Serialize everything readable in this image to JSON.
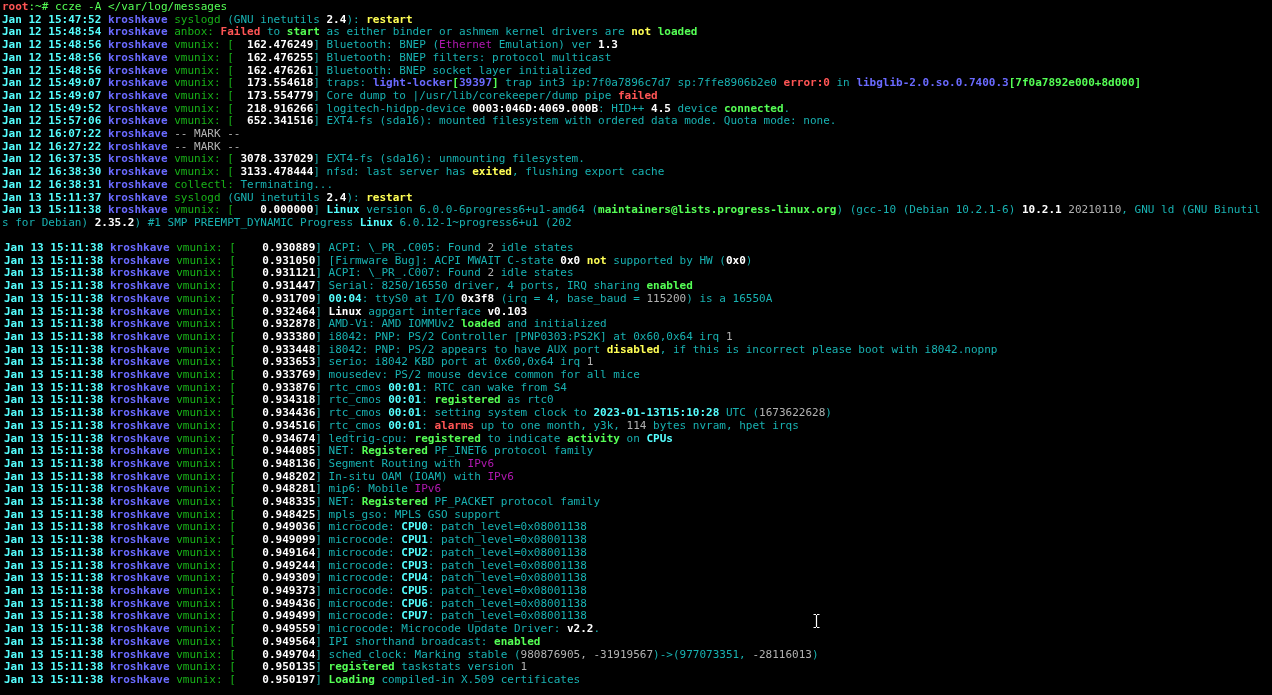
{
  "top_pane": {
    "lines": [
      {
        "segs": [
          {
            "kind": "user",
            "text": "root"
          },
          {
            "kind": "prompt",
            "text": ":~# ccze -A </var/log/messages"
          }
        ]
      },
      {
        "date": "Jan 12 15:47:52",
        "host": "kroshkave",
        "segs": [
          {
            "kind": "prog",
            "text": "syslogd"
          },
          {
            "kind": "msg",
            "text": " (GNU inetutils "
          },
          {
            "kind": "white",
            "text": "2.4"
          },
          {
            "kind": "msg",
            "text": "): "
          },
          {
            "kind": "warn",
            "text": "restart"
          }
        ]
      },
      {
        "date": "Jan 12 15:48:54",
        "host": "kroshkave",
        "segs": [
          {
            "kind": "prog",
            "text": "anbox:"
          },
          {
            "kind": "bad",
            "text": " Failed"
          },
          {
            "kind": "msg",
            "text": " to "
          },
          {
            "kind": "good",
            "text": "start"
          },
          {
            "kind": "msg",
            "text": " as either binder or ashmem kernel drivers are "
          },
          {
            "kind": "warn",
            "text": "not"
          },
          {
            "kind": "good",
            "text": " loaded"
          }
        ]
      },
      {
        "date": "Jan 12 15:48:56",
        "host": "kroshkave",
        "segs": [
          {
            "kind": "prog",
            "text": "vmunix: ["
          },
          {
            "kind": "white",
            "text": "  162.476249"
          },
          {
            "kind": "msg",
            "text": "] Bluetooth: BNEP ("
          },
          {
            "kind": "purple",
            "text": "Ethernet"
          },
          {
            "kind": "msg",
            "text": " Emulation) ver "
          },
          {
            "kind": "white",
            "text": "1.3"
          }
        ]
      },
      {
        "date": "Jan 12 15:48:56",
        "host": "kroshkave",
        "segs": [
          {
            "kind": "prog",
            "text": "vmunix: ["
          },
          {
            "kind": "white",
            "text": "  162.476255"
          },
          {
            "kind": "msg",
            "text": "] Bluetooth: BNEP filters: protocol multicast"
          }
        ]
      },
      {
        "date": "Jan 12 15:48:56",
        "host": "kroshkave",
        "segs": [
          {
            "kind": "prog",
            "text": "vmunix: ["
          },
          {
            "kind": "white",
            "text": "  162.476261"
          },
          {
            "kind": "msg",
            "text": "] Bluetooth: BNEP socket layer initialized"
          }
        ]
      },
      {
        "date": "Jan 12 15:49:07",
        "host": "kroshkave",
        "segs": [
          {
            "kind": "prog",
            "text": "vmunix: ["
          },
          {
            "kind": "white",
            "text": "  173.554618"
          },
          {
            "kind": "msg",
            "text": "] traps: "
          },
          {
            "kind": "blue",
            "text": "light-locker"
          },
          {
            "kind": "good",
            "text": "["
          },
          {
            "kind": "blue",
            "text": "39397"
          },
          {
            "kind": "good",
            "text": "]"
          },
          {
            "kind": "msg",
            "text": " trap int3 ip:7f0a7896c7d7 sp:7ffe8906b2e0 "
          },
          {
            "kind": "bad",
            "text": "error:0"
          },
          {
            "kind": "msg",
            "text": " in "
          },
          {
            "kind": "blue",
            "text": "libglib-2.0.so.0.7400.3"
          },
          {
            "kind": "good",
            "text": "[7f0a7892e000+8d000]"
          }
        ]
      },
      {
        "date": "Jan 12 15:49:07",
        "host": "kroshkave",
        "segs": [
          {
            "kind": "prog",
            "text": "vmunix: ["
          },
          {
            "kind": "white",
            "text": "  173.554779"
          },
          {
            "kind": "msg",
            "text": "] Core dump to |/usr/lib/corekeeper/dump pipe "
          },
          {
            "kind": "bad",
            "text": "failed"
          }
        ]
      },
      {
        "date": "Jan 12 15:49:52",
        "host": "kroshkave",
        "segs": [
          {
            "kind": "prog",
            "text": "vmunix: ["
          },
          {
            "kind": "white",
            "text": "  218.916266"
          },
          {
            "kind": "msg",
            "text": "] logitech-hidpp-device "
          },
          {
            "kind": "white",
            "text": "0003:046D:4069.000B"
          },
          {
            "kind": "msg",
            "text": ": HID++ "
          },
          {
            "kind": "white",
            "text": "4.5"
          },
          {
            "kind": "msg",
            "text": " device "
          },
          {
            "kind": "good",
            "text": "connected"
          },
          {
            "kind": "msg",
            "text": "."
          }
        ]
      },
      {
        "date": "Jan 12 15:57:06",
        "host": "kroshkave",
        "segs": [
          {
            "kind": "prog",
            "text": "vmunix: ["
          },
          {
            "kind": "white",
            "text": "  652.341516"
          },
          {
            "kind": "msg",
            "text": "] EXT4-fs (sda16): mounted filesystem with ordered data mode. Quota mode: none."
          }
        ]
      },
      {
        "date": "Jan 12 16:07:22",
        "host": "kroshkave",
        "segs": [
          {
            "kind": "gray",
            "text": "-- MARK --"
          }
        ]
      },
      {
        "date": "Jan 12 16:27:22",
        "host": "kroshkave",
        "segs": [
          {
            "kind": "gray",
            "text": "-- MARK --"
          }
        ]
      },
      {
        "date": "Jan 12 16:37:35",
        "host": "kroshkave",
        "segs": [
          {
            "kind": "prog",
            "text": "vmunix: ["
          },
          {
            "kind": "white",
            "text": " 3078.337029"
          },
          {
            "kind": "msg",
            "text": "] EXT4-fs (sda16): unmounting filesystem."
          }
        ]
      },
      {
        "date": "Jan 12 16:38:30",
        "host": "kroshkave",
        "segs": [
          {
            "kind": "prog",
            "text": "vmunix: ["
          },
          {
            "kind": "white",
            "text": " 3133.478444"
          },
          {
            "kind": "msg",
            "text": "] nfsd: last server has "
          },
          {
            "kind": "warn",
            "text": "exited"
          },
          {
            "kind": "msg",
            "text": ", flushing export cache"
          }
        ]
      },
      {
        "date": "Jan 12 16:38:31",
        "host": "kroshkave",
        "segs": [
          {
            "kind": "prog",
            "text": "collectl:"
          },
          {
            "kind": "msg",
            "text": " Terminating..."
          }
        ]
      },
      {
        "date": "Jan 13 15:11:37",
        "host": "kroshkave",
        "segs": [
          {
            "kind": "prog",
            "text": "syslogd"
          },
          {
            "kind": "msg",
            "text": " (GNU inetutils "
          },
          {
            "kind": "white",
            "text": "2.4"
          },
          {
            "kind": "msg",
            "text": "): "
          },
          {
            "kind": "warn",
            "text": "restart"
          }
        ]
      },
      {
        "date": "Jan 13 15:11:38",
        "host": "kroshkave",
        "segs": [
          {
            "kind": "prog",
            "text": "vmunix: ["
          },
          {
            "kind": "white",
            "text": "    0.000000"
          },
          {
            "kind": "msg",
            "text": "] "
          },
          {
            "kind": "cyan",
            "text": "Linux"
          },
          {
            "kind": "msg",
            "text": " version 6.0.0-6progress6+u1-amd64 ("
          },
          {
            "kind": "good",
            "text": "maintainers@lists.progress-linux.org"
          },
          {
            "kind": "msg",
            "text": ") (gcc-10 (Debian 10.2.1-6) "
          },
          {
            "kind": "white",
            "text": "10.2.1"
          },
          {
            "kind": "gray",
            "text": " 20210110"
          },
          {
            "kind": "msg",
            "text": ", GNU ld (GNU Binutil"
          }
        ]
      },
      {
        "segs": [
          {
            "kind": "msg",
            "text": "s for Debian) "
          },
          {
            "kind": "white",
            "text": "2.35.2"
          },
          {
            "kind": "msg",
            "text": ") #1 SMP PREEMPT_DYNAMIC Progress "
          },
          {
            "kind": "cyan",
            "text": "Linux"
          },
          {
            "kind": "msg",
            "text": " 6.0.12-1~progress6+u1 (202"
          }
        ]
      }
    ]
  },
  "bottom_pane": {
    "lines": [
      {
        "date": "Jan 13 15:11:38",
        "host": "kroshkave",
        "segs": [
          {
            "kind": "prog",
            "text": "vmunix: ["
          },
          {
            "kind": "white",
            "text": "    0.930889"
          },
          {
            "kind": "msg",
            "text": "] ACPI: \\_PR_.C005: Found "
          },
          {
            "kind": "gray",
            "text": "2"
          },
          {
            "kind": "msg",
            "text": " idle states"
          }
        ]
      },
      {
        "date": "Jan 13 15:11:38",
        "host": "kroshkave",
        "segs": [
          {
            "kind": "prog",
            "text": "vmunix: ["
          },
          {
            "kind": "white",
            "text": "    0.931050"
          },
          {
            "kind": "msg",
            "text": "] [Firmware Bug]: ACPI MWAIT C-state "
          },
          {
            "kind": "white",
            "text": "0x0"
          },
          {
            "kind": "warn",
            "text": " not"
          },
          {
            "kind": "msg",
            "text": " supported by HW ("
          },
          {
            "kind": "white",
            "text": "0x0"
          },
          {
            "kind": "msg",
            "text": ")"
          }
        ]
      },
      {
        "date": "Jan 13 15:11:38",
        "host": "kroshkave",
        "segs": [
          {
            "kind": "prog",
            "text": "vmunix: ["
          },
          {
            "kind": "white",
            "text": "    0.931121"
          },
          {
            "kind": "msg",
            "text": "] ACPI: \\_PR_.C007: Found "
          },
          {
            "kind": "gray",
            "text": "2"
          },
          {
            "kind": "msg",
            "text": " idle states"
          }
        ]
      },
      {
        "date": "Jan 13 15:11:38",
        "host": "kroshkave",
        "segs": [
          {
            "kind": "prog",
            "text": "vmunix: ["
          },
          {
            "kind": "white",
            "text": "    0.931447"
          },
          {
            "kind": "msg",
            "text": "] Serial: 8250/16550 driver, 4 ports, IRQ sharing "
          },
          {
            "kind": "good",
            "text": "enabled"
          }
        ]
      },
      {
        "date": "Jan 13 15:11:38",
        "host": "kroshkave",
        "segs": [
          {
            "kind": "prog",
            "text": "vmunix: ["
          },
          {
            "kind": "white",
            "text": "    0.931709"
          },
          {
            "kind": "msg",
            "text": "] "
          },
          {
            "kind": "cyan",
            "text": "00:04"
          },
          {
            "kind": "msg",
            "text": ": ttyS0 at I/O "
          },
          {
            "kind": "white",
            "text": "0x3f8"
          },
          {
            "kind": "msg",
            "text": " (irq = 4, base_baud = "
          },
          {
            "kind": "gray",
            "text": "115200"
          },
          {
            "kind": "msg",
            "text": ") is a 16550A"
          }
        ]
      },
      {
        "date": "Jan 13 15:11:38",
        "host": "kroshkave",
        "segs": [
          {
            "kind": "prog",
            "text": "vmunix: ["
          },
          {
            "kind": "white",
            "text": "    0.932464"
          },
          {
            "kind": "msg",
            "text": "] "
          },
          {
            "kind": "white",
            "text": "Linux"
          },
          {
            "kind": "msg",
            "text": " agpgart interface "
          },
          {
            "kind": "white",
            "text": "v0.103"
          }
        ]
      },
      {
        "date": "Jan 13 15:11:38",
        "host": "kroshkave",
        "segs": [
          {
            "kind": "prog",
            "text": "vmunix: ["
          },
          {
            "kind": "white",
            "text": "    0.932878"
          },
          {
            "kind": "msg",
            "text": "] AMD-Vi: AMD IOMMUv2 "
          },
          {
            "kind": "good",
            "text": "loaded"
          },
          {
            "kind": "msg",
            "text": " and initialized"
          }
        ]
      },
      {
        "date": "Jan 13 15:11:38",
        "host": "kroshkave",
        "segs": [
          {
            "kind": "prog",
            "text": "vmunix: ["
          },
          {
            "kind": "white",
            "text": "    0.933380"
          },
          {
            "kind": "msg",
            "text": "] i8042: PNP: PS/2 Controller [PNP0303:PS2K] at 0x60,0x64 irq "
          },
          {
            "kind": "gray",
            "text": "1"
          }
        ]
      },
      {
        "date": "Jan 13 15:11:38",
        "host": "kroshkave",
        "segs": [
          {
            "kind": "prog",
            "text": "vmunix: ["
          },
          {
            "kind": "white",
            "text": "    0.933448"
          },
          {
            "kind": "msg",
            "text": "] i8042: PNP: PS/2 appears to have AUX port "
          },
          {
            "kind": "warn",
            "text": "disabled"
          },
          {
            "kind": "msg",
            "text": ", if this is incorrect please boot with i8042.nopnp"
          }
        ]
      },
      {
        "date": "Jan 13 15:11:38",
        "host": "kroshkave",
        "segs": [
          {
            "kind": "prog",
            "text": "vmunix: ["
          },
          {
            "kind": "white",
            "text": "    0.933653"
          },
          {
            "kind": "msg",
            "text": "] serio: i8042 KBD port at 0x60,0x64 irq "
          },
          {
            "kind": "gray",
            "text": "1"
          }
        ]
      },
      {
        "date": "Jan 13 15:11:38",
        "host": "kroshkave",
        "segs": [
          {
            "kind": "prog",
            "text": "vmunix: ["
          },
          {
            "kind": "white",
            "text": "    0.933769"
          },
          {
            "kind": "msg",
            "text": "] mousedev: PS/2 mouse device common for all mice"
          }
        ]
      },
      {
        "date": "Jan 13 15:11:38",
        "host": "kroshkave",
        "segs": [
          {
            "kind": "prog",
            "text": "vmunix: ["
          },
          {
            "kind": "white",
            "text": "    0.933876"
          },
          {
            "kind": "msg",
            "text": "] rtc_cmos "
          },
          {
            "kind": "cyan",
            "text": "00:01"
          },
          {
            "kind": "msg",
            "text": ": RTC can wake from S4"
          }
        ]
      },
      {
        "date": "Jan 13 15:11:38",
        "host": "kroshkave",
        "segs": [
          {
            "kind": "prog",
            "text": "vmunix: ["
          },
          {
            "kind": "white",
            "text": "    0.934318"
          },
          {
            "kind": "msg",
            "text": "] rtc_cmos "
          },
          {
            "kind": "cyan",
            "text": "00:01"
          },
          {
            "kind": "msg",
            "text": ": "
          },
          {
            "kind": "good",
            "text": "registered"
          },
          {
            "kind": "msg",
            "text": " as rtc0"
          }
        ]
      },
      {
        "date": "Jan 13 15:11:38",
        "host": "kroshkave",
        "segs": [
          {
            "kind": "prog",
            "text": "vmunix: ["
          },
          {
            "kind": "white",
            "text": "    0.934436"
          },
          {
            "kind": "msg",
            "text": "] rtc_cmos "
          },
          {
            "kind": "cyan",
            "text": "00:01"
          },
          {
            "kind": "msg",
            "text": ": setting system clock to "
          },
          {
            "kind": "cyan",
            "text": "2023-01-13T15:10:28"
          },
          {
            "kind": "msg",
            "text": " UTC ("
          },
          {
            "kind": "gray",
            "text": "1673622628"
          },
          {
            "kind": "msg",
            "text": ")"
          }
        ]
      },
      {
        "date": "Jan 13 15:11:38",
        "host": "kroshkave",
        "segs": [
          {
            "kind": "prog",
            "text": "vmunix: ["
          },
          {
            "kind": "white",
            "text": "    0.934516"
          },
          {
            "kind": "msg",
            "text": "] rtc_cmos "
          },
          {
            "kind": "cyan",
            "text": "00:01"
          },
          {
            "kind": "msg",
            "text": ": "
          },
          {
            "kind": "bad",
            "text": "alarms"
          },
          {
            "kind": "msg",
            "text": " up to one month, y3k, "
          },
          {
            "kind": "gray",
            "text": "114"
          },
          {
            "kind": "msg",
            "text": " bytes nvram, hpet irqs"
          }
        ]
      },
      {
        "date": "Jan 13 15:11:38",
        "host": "kroshkave",
        "segs": [
          {
            "kind": "prog",
            "text": "vmunix: ["
          },
          {
            "kind": "white",
            "text": "    0.934674"
          },
          {
            "kind": "msg",
            "text": "] ledtrig-cpu: "
          },
          {
            "kind": "good",
            "text": "registered"
          },
          {
            "kind": "msg",
            "text": " to indicate "
          },
          {
            "kind": "good",
            "text": "activity"
          },
          {
            "kind": "msg",
            "text": " on "
          },
          {
            "kind": "cyan",
            "text": "CPUs"
          }
        ]
      },
      {
        "date": "Jan 13 15:11:38",
        "host": "kroshkave",
        "segs": [
          {
            "kind": "prog",
            "text": "vmunix: ["
          },
          {
            "kind": "white",
            "text": "    0.944085"
          },
          {
            "kind": "msg",
            "text": "] NET: "
          },
          {
            "kind": "good",
            "text": "Registered"
          },
          {
            "kind": "msg",
            "text": " PF_INET6 protocol family"
          }
        ]
      },
      {
        "date": "Jan 13 15:11:38",
        "host": "kroshkave",
        "segs": [
          {
            "kind": "prog",
            "text": "vmunix: ["
          },
          {
            "kind": "white",
            "text": "    0.948136"
          },
          {
            "kind": "msg",
            "text": "] Segment Routing with "
          },
          {
            "kind": "purple",
            "text": "IPv6"
          }
        ]
      },
      {
        "date": "Jan 13 15:11:38",
        "host": "kroshkave",
        "segs": [
          {
            "kind": "prog",
            "text": "vmunix: ["
          },
          {
            "kind": "white",
            "text": "    0.948202"
          },
          {
            "kind": "msg",
            "text": "] In-situ OAM (IOAM) with "
          },
          {
            "kind": "purple",
            "text": "IPv6"
          }
        ]
      },
      {
        "date": "Jan 13 15:11:38",
        "host": "kroshkave",
        "segs": [
          {
            "kind": "prog",
            "text": "vmunix: ["
          },
          {
            "kind": "white",
            "text": "    0.948281"
          },
          {
            "kind": "msg",
            "text": "] mip6: Mobile "
          },
          {
            "kind": "purple",
            "text": "IPv6"
          }
        ]
      },
      {
        "date": "Jan 13 15:11:38",
        "host": "kroshkave",
        "segs": [
          {
            "kind": "prog",
            "text": "vmunix: ["
          },
          {
            "kind": "white",
            "text": "    0.948335"
          },
          {
            "kind": "msg",
            "text": "] NET: "
          },
          {
            "kind": "good",
            "text": "Registered"
          },
          {
            "kind": "msg",
            "text": " PF_PACKET protocol family"
          }
        ]
      },
      {
        "date": "Jan 13 15:11:38",
        "host": "kroshkave",
        "segs": [
          {
            "kind": "prog",
            "text": "vmunix: ["
          },
          {
            "kind": "white",
            "text": "    0.948425"
          },
          {
            "kind": "msg",
            "text": "] mpls_gso: MPLS GSO support"
          }
        ]
      },
      {
        "date": "Jan 13 15:11:38",
        "host": "kroshkave",
        "segs": [
          {
            "kind": "prog",
            "text": "vmunix: ["
          },
          {
            "kind": "white",
            "text": "    0.949036"
          },
          {
            "kind": "msg",
            "text": "] microcode: "
          },
          {
            "kind": "cyan",
            "text": "CPU0"
          },
          {
            "kind": "msg",
            "text": ": patch_level=0x08001138"
          }
        ]
      },
      {
        "date": "Jan 13 15:11:38",
        "host": "kroshkave",
        "segs": [
          {
            "kind": "prog",
            "text": "vmunix: ["
          },
          {
            "kind": "white",
            "text": "    0.949099"
          },
          {
            "kind": "msg",
            "text": "] microcode: "
          },
          {
            "kind": "cyan",
            "text": "CPU1"
          },
          {
            "kind": "msg",
            "text": ": patch_level=0x08001138"
          }
        ]
      },
      {
        "date": "Jan 13 15:11:38",
        "host": "kroshkave",
        "segs": [
          {
            "kind": "prog",
            "text": "vmunix: ["
          },
          {
            "kind": "white",
            "text": "    0.949164"
          },
          {
            "kind": "msg",
            "text": "] microcode: "
          },
          {
            "kind": "cyan",
            "text": "CPU2"
          },
          {
            "kind": "msg",
            "text": ": patch_level=0x08001138"
          }
        ]
      },
      {
        "date": "Jan 13 15:11:38",
        "host": "kroshkave",
        "segs": [
          {
            "kind": "prog",
            "text": "vmunix: ["
          },
          {
            "kind": "white",
            "text": "    0.949244"
          },
          {
            "kind": "msg",
            "text": "] microcode: "
          },
          {
            "kind": "cyan",
            "text": "CPU3"
          },
          {
            "kind": "msg",
            "text": ": patch_level=0x08001138"
          }
        ]
      },
      {
        "date": "Jan 13 15:11:38",
        "host": "kroshkave",
        "segs": [
          {
            "kind": "prog",
            "text": "vmunix: ["
          },
          {
            "kind": "white",
            "text": "    0.949309"
          },
          {
            "kind": "msg",
            "text": "] microcode: "
          },
          {
            "kind": "cyan",
            "text": "CPU4"
          },
          {
            "kind": "msg",
            "text": ": patch_level=0x08001138"
          }
        ]
      },
      {
        "date": "Jan 13 15:11:38",
        "host": "kroshkave",
        "segs": [
          {
            "kind": "prog",
            "text": "vmunix: ["
          },
          {
            "kind": "white",
            "text": "    0.949373"
          },
          {
            "kind": "msg",
            "text": "] microcode: "
          },
          {
            "kind": "cyan",
            "text": "CPU5"
          },
          {
            "kind": "msg",
            "text": ": patch_level=0x08001138"
          }
        ]
      },
      {
        "date": "Jan 13 15:11:38",
        "host": "kroshkave",
        "segs": [
          {
            "kind": "prog",
            "text": "vmunix: ["
          },
          {
            "kind": "white",
            "text": "    0.949436"
          },
          {
            "kind": "msg",
            "text": "] microcode: "
          },
          {
            "kind": "cyan",
            "text": "CPU6"
          },
          {
            "kind": "msg",
            "text": ": patch_level=0x08001138"
          }
        ]
      },
      {
        "date": "Jan 13 15:11:38",
        "host": "kroshkave",
        "segs": [
          {
            "kind": "prog",
            "text": "vmunix: ["
          },
          {
            "kind": "white",
            "text": "    0.949499"
          },
          {
            "kind": "msg",
            "text": "] microcode: "
          },
          {
            "kind": "cyan",
            "text": "CPU7"
          },
          {
            "kind": "msg",
            "text": ": patch_level=0x08001138"
          }
        ]
      },
      {
        "date": "Jan 13 15:11:38",
        "host": "kroshkave",
        "segs": [
          {
            "kind": "prog",
            "text": "vmunix: ["
          },
          {
            "kind": "white",
            "text": "    0.949559"
          },
          {
            "kind": "msg",
            "text": "] microcode: Microcode Update Driver: "
          },
          {
            "kind": "white",
            "text": "v2.2"
          },
          {
            "kind": "msg",
            "text": "."
          }
        ]
      },
      {
        "date": "Jan 13 15:11:38",
        "host": "kroshkave",
        "segs": [
          {
            "kind": "prog",
            "text": "vmunix: ["
          },
          {
            "kind": "white",
            "text": "    0.949564"
          },
          {
            "kind": "msg",
            "text": "] IPI shorthand broadcast: "
          },
          {
            "kind": "good",
            "text": "enabled"
          }
        ]
      },
      {
        "date": "Jan 13 15:11:38",
        "host": "kroshkave",
        "segs": [
          {
            "kind": "prog",
            "text": "vmunix: ["
          },
          {
            "kind": "white",
            "text": "    0.949704"
          },
          {
            "kind": "msg",
            "text": "] sched_clock: Marking stable ("
          },
          {
            "kind": "gray",
            "text": "980876905, -31919567"
          },
          {
            "kind": "msg",
            "text": ")->(977073351, "
          },
          {
            "kind": "gray",
            "text": "-28116013"
          },
          {
            "kind": "msg",
            "text": ")"
          }
        ]
      },
      {
        "date": "Jan 13 15:11:38",
        "host": "kroshkave",
        "segs": [
          {
            "kind": "prog",
            "text": "vmunix: ["
          },
          {
            "kind": "white",
            "text": "    0.950135"
          },
          {
            "kind": "msg",
            "text": "] "
          },
          {
            "kind": "good",
            "text": "registered"
          },
          {
            "kind": "msg",
            "text": " taskstats version "
          },
          {
            "kind": "gray",
            "text": "1"
          }
        ]
      },
      {
        "date": "Jan 13 15:11:38",
        "host": "kroshkave",
        "segs": [
          {
            "kind": "prog",
            "text": "vmunix: ["
          },
          {
            "kind": "white",
            "text": "    0.950197"
          },
          {
            "kind": "msg",
            "text": "] "
          },
          {
            "kind": "good",
            "text": "Loading"
          },
          {
            "kind": "msg",
            "text": " compiled-in X.509 certificates"
          }
        ]
      }
    ]
  }
}
